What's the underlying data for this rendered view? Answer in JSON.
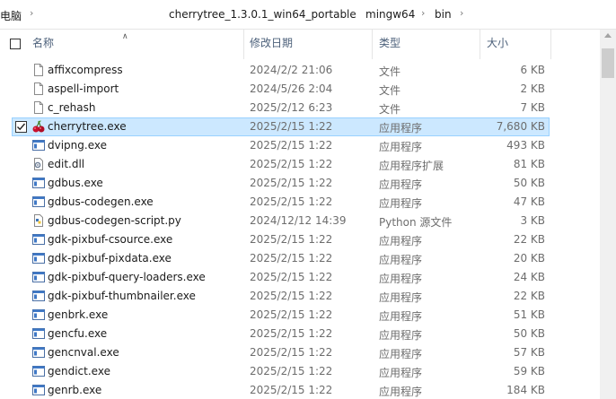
{
  "address": {
    "root": "电脑",
    "crumbs": [
      "cherrytree_1.3.0.1_win64_portable",
      "mingw64",
      "bin"
    ]
  },
  "columns": {
    "name": "名称",
    "date": "修改日期",
    "type": "类型",
    "size": "大小"
  },
  "files": [
    {
      "name": "affixcompress",
      "date": "2024/2/2 21:06",
      "type": "文件",
      "size": "6 KB",
      "icon": "blank-file-icon"
    },
    {
      "name": "aspell-import",
      "date": "2024/5/26 2:04",
      "type": "文件",
      "size": "2 KB",
      "icon": "blank-file-icon"
    },
    {
      "name": "c_rehash",
      "date": "2025/2/12 6:23",
      "type": "文件",
      "size": "7 KB",
      "icon": "blank-file-icon"
    },
    {
      "name": "cherrytree.exe",
      "date": "2025/2/15 1:22",
      "type": "应用程序",
      "size": "7,680 KB",
      "icon": "cherry-icon",
      "selected": true
    },
    {
      "name": "dvipng.exe",
      "date": "2025/2/15 1:22",
      "type": "应用程序",
      "size": "493 KB",
      "icon": "app-exe-icon"
    },
    {
      "name": "edit.dll",
      "date": "2025/2/15 1:22",
      "type": "应用程序扩展",
      "size": "81 KB",
      "icon": "dll-gear-icon"
    },
    {
      "name": "gdbus.exe",
      "date": "2025/2/15 1:22",
      "type": "应用程序",
      "size": "50 KB",
      "icon": "app-exe-icon"
    },
    {
      "name": "gdbus-codegen.exe",
      "date": "2025/2/15 1:22",
      "type": "应用程序",
      "size": "47 KB",
      "icon": "app-exe-icon"
    },
    {
      "name": "gdbus-codegen-script.py",
      "date": "2024/12/12 14:39",
      "type": "Python 源文件",
      "size": "3 KB",
      "icon": "python-file-icon"
    },
    {
      "name": "gdk-pixbuf-csource.exe",
      "date": "2025/2/15 1:22",
      "type": "应用程序",
      "size": "22 KB",
      "icon": "app-exe-icon"
    },
    {
      "name": "gdk-pixbuf-pixdata.exe",
      "date": "2025/2/15 1:22",
      "type": "应用程序",
      "size": "20 KB",
      "icon": "app-exe-icon"
    },
    {
      "name": "gdk-pixbuf-query-loaders.exe",
      "date": "2025/2/15 1:22",
      "type": "应用程序",
      "size": "24 KB",
      "icon": "app-exe-icon"
    },
    {
      "name": "gdk-pixbuf-thumbnailer.exe",
      "date": "2025/2/15 1:22",
      "type": "应用程序",
      "size": "22 KB",
      "icon": "app-exe-icon"
    },
    {
      "name": "genbrk.exe",
      "date": "2025/2/15 1:22",
      "type": "应用程序",
      "size": "51 KB",
      "icon": "app-exe-icon"
    },
    {
      "name": "gencfu.exe",
      "date": "2025/2/15 1:22",
      "type": "应用程序",
      "size": "50 KB",
      "icon": "app-exe-icon"
    },
    {
      "name": "gencnval.exe",
      "date": "2025/2/15 1:22",
      "type": "应用程序",
      "size": "57 KB",
      "icon": "app-exe-icon"
    },
    {
      "name": "gendict.exe",
      "date": "2025/2/15 1:22",
      "type": "应用程序",
      "size": "59 KB",
      "icon": "app-exe-icon"
    },
    {
      "name": "genrb.exe",
      "date": "2025/2/15 1:22",
      "type": "应用程序",
      "size": "184 KB",
      "icon": "app-exe-icon"
    }
  ],
  "colors": {
    "selection_fill": "#cce8ff",
    "selection_border": "#99d1ff",
    "header_text": "#4c607a",
    "secondary_text": "#6d6d6d"
  }
}
